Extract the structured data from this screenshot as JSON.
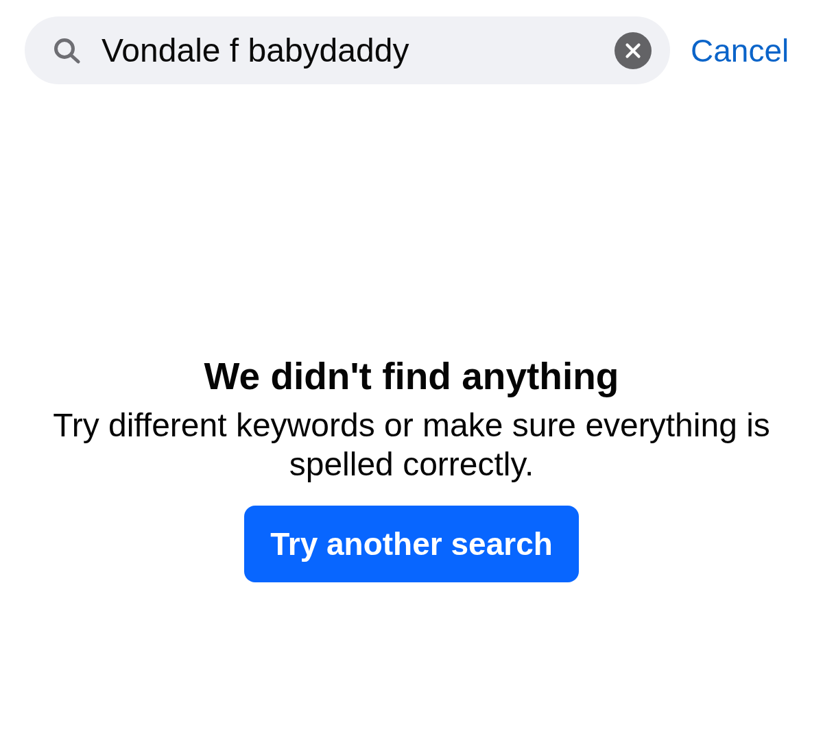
{
  "search": {
    "value": "Vondale f babydaddy"
  },
  "cancel": "Cancel",
  "empty_state": {
    "title": "We didn't find anything",
    "message": "Try different keywords or make sure everything is spelled correctly.",
    "button": "Try another search"
  }
}
